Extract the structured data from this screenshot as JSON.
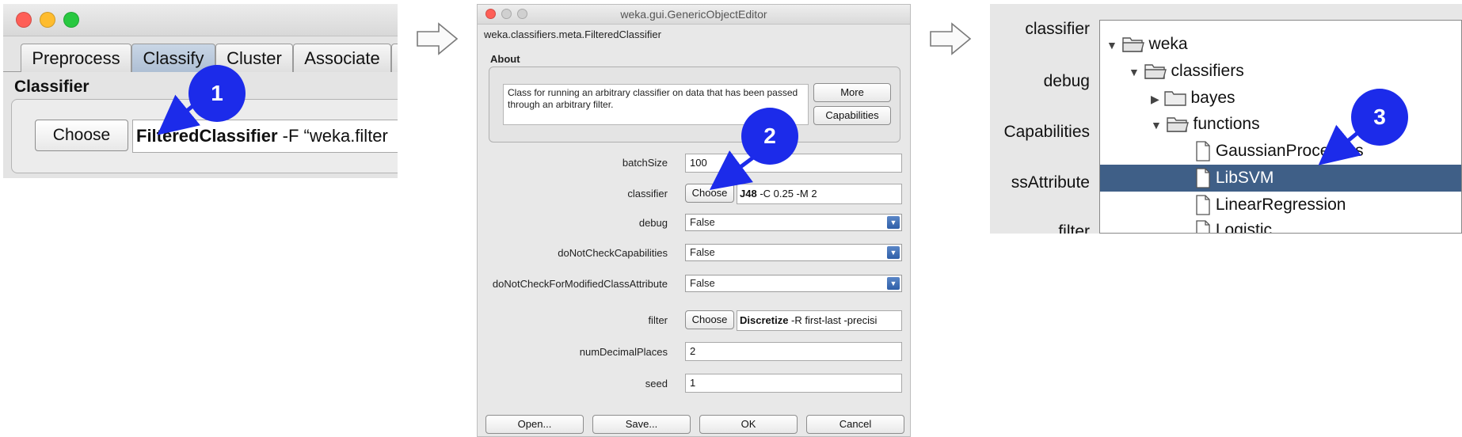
{
  "panel1": {
    "tabs": [
      {
        "label": "Preprocess"
      },
      {
        "label": "Classify"
      },
      {
        "label": "Cluster"
      },
      {
        "label": "Associate"
      }
    ],
    "section_label": "Classifier",
    "choose_label": "Choose",
    "classifier_name": "FilteredClassifier",
    "classifier_options": " -F “weka.filter"
  },
  "panel2": {
    "window_title": "weka.gui.GenericObjectEditor",
    "class_name": "weka.classifiers.meta.FilteredClassifier",
    "about_label": "About",
    "about_text": "Class for running an arbitrary classifier on data that has been passed through an arbitrary filter.",
    "more_label": "More",
    "capabilities_label": "Capabilities",
    "properties": {
      "batchSize": {
        "label": "batchSize",
        "value": "100"
      },
      "classifier": {
        "label": "classifier",
        "choose": "Choose",
        "name": "J48",
        "options": " -C 0.25 -M 2"
      },
      "debug": {
        "label": "debug",
        "value": "False"
      },
      "doNotCheckCapabilities": {
        "label": "doNotCheckCapabilities",
        "value": "False"
      },
      "doNotCheckForModifiedClassAttribute": {
        "label": "doNotCheckForModifiedClassAttribute",
        "value": "False"
      },
      "filter": {
        "label": "filter",
        "choose": "Choose",
        "name": "Discretize",
        "options": " -R first-last -precisi"
      },
      "numDecimalPlaces": {
        "label": "numDecimalPlaces",
        "value": "2"
      },
      "seed": {
        "label": "seed",
        "value": "1"
      }
    },
    "buttons": {
      "open": "Open...",
      "save": "Save...",
      "ok": "OK",
      "cancel": "Cancel"
    }
  },
  "panel3": {
    "side_labels": [
      "classifier",
      "debug",
      "Capabilities",
      "ssAttribute",
      "filter"
    ],
    "tree": {
      "weka": "weka",
      "classifiers": "classifiers",
      "bayes": "bayes",
      "functions": "functions",
      "leaves": [
        "GaussianProcesses",
        "LibSVM",
        "LinearRegression",
        "Logistic"
      ]
    }
  },
  "steps": [
    "1",
    "2",
    "3"
  ],
  "colors": {
    "badge": "#1c2bea",
    "selection": "#3f5f87",
    "tab_active": "#b6c6da"
  }
}
